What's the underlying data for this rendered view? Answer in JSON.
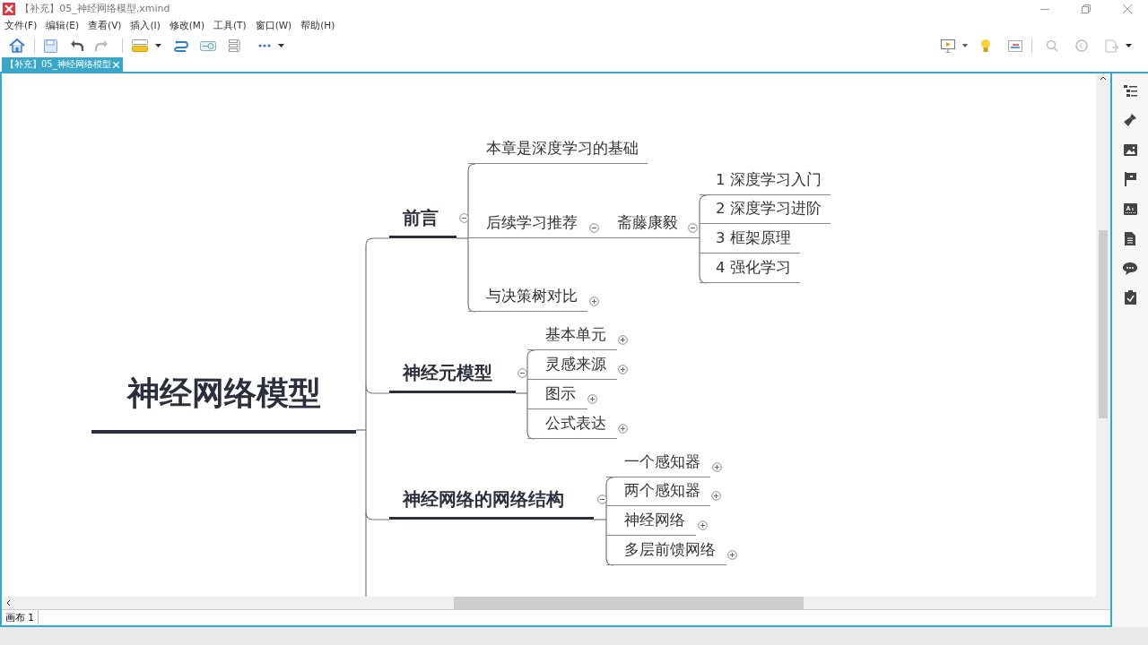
{
  "window": {
    "title": "【补充】05_神经网络模型.xmind"
  },
  "menu": [
    "文件(F)",
    "编辑(E)",
    "查看(V)",
    "插入(I)",
    "修改(M)",
    "工具(T)",
    "窗口(W)",
    "帮助(H)"
  ],
  "document_tabs": [
    {
      "label": "【补充】05_神经网络模型",
      "selected": true
    }
  ],
  "map": {
    "label": "神经网络模型",
    "children": [
      {
        "label": "前言",
        "expanded": true,
        "children": [
          {
            "label": "本章是深度学习的基础"
          },
          {
            "label": "后续学习推荐",
            "expanded": true,
            "children": [
              {
                "label": "斋藤康毅",
                "expanded": true,
                "children": [
                  {
                    "label": "1 深度学习入门"
                  },
                  {
                    "label": "2 深度学习进阶"
                  },
                  {
                    "label": "3 框架原理"
                  },
                  {
                    "label": "4 强化学习"
                  }
                ]
              }
            ]
          },
          {
            "label": "与决策树对比",
            "expanded": false
          }
        ]
      },
      {
        "label": "神经元模型",
        "expanded": true,
        "children": [
          {
            "label": "基本单元",
            "expanded": false
          },
          {
            "label": "灵感来源",
            "expanded": false
          },
          {
            "label": "图示",
            "expanded": false
          },
          {
            "label": "公式表达",
            "expanded": false
          }
        ]
      },
      {
        "label": "神经网络的网络结构",
        "expanded": true,
        "children": [
          {
            "label": "一个感知器",
            "expanded": false
          },
          {
            "label": "两个感知器",
            "expanded": false
          },
          {
            "label": "神经网络",
            "expanded": false
          },
          {
            "label": "多层前馈网络",
            "expanded": false
          }
        ]
      }
    ]
  },
  "sheets": [
    {
      "label": "画布 1",
      "selected": true
    }
  ]
}
